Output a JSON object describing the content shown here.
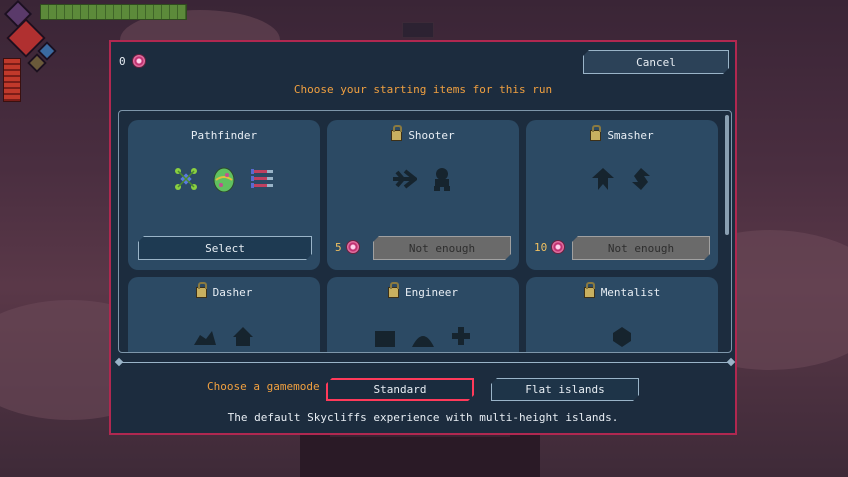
{
  "hud": {
    "currency": "0"
  },
  "dialog": {
    "currency_count": "0",
    "cancel_label": "Cancel",
    "subtitle": "Choose your starting items for this run",
    "accent": "#b02850",
    "highlight": "#f0a040"
  },
  "cards": [
    {
      "name": "Pathfinder",
      "locked": false,
      "action": "Select",
      "icons": [
        "ward-icon",
        "egg-icon",
        "darts-icon"
      ]
    },
    {
      "name": "Shooter",
      "locked": true,
      "cost": "5",
      "action": "Not enough",
      "icons": [
        "arrows-icon",
        "figure-icon"
      ]
    },
    {
      "name": "Smasher",
      "locked": true,
      "cost": "10",
      "action": "Not enough",
      "icons": [
        "shard-icon",
        "swap-icon"
      ]
    },
    {
      "name": "Dasher",
      "locked": true,
      "icons": [
        "wing-icon",
        "house-icon"
      ]
    },
    {
      "name": "Engineer",
      "locked": true,
      "icons": [
        "box-icon",
        "dome-icon",
        "cross-icon"
      ]
    },
    {
      "name": "Mentalist",
      "locked": true,
      "icons": [
        "brain-icon"
      ]
    }
  ],
  "gamemode": {
    "label": "Choose a gamemode",
    "options": [
      "Standard",
      "Flat islands"
    ],
    "selected": "Standard",
    "description": "The default Skycliffs experience with multi-height islands."
  }
}
